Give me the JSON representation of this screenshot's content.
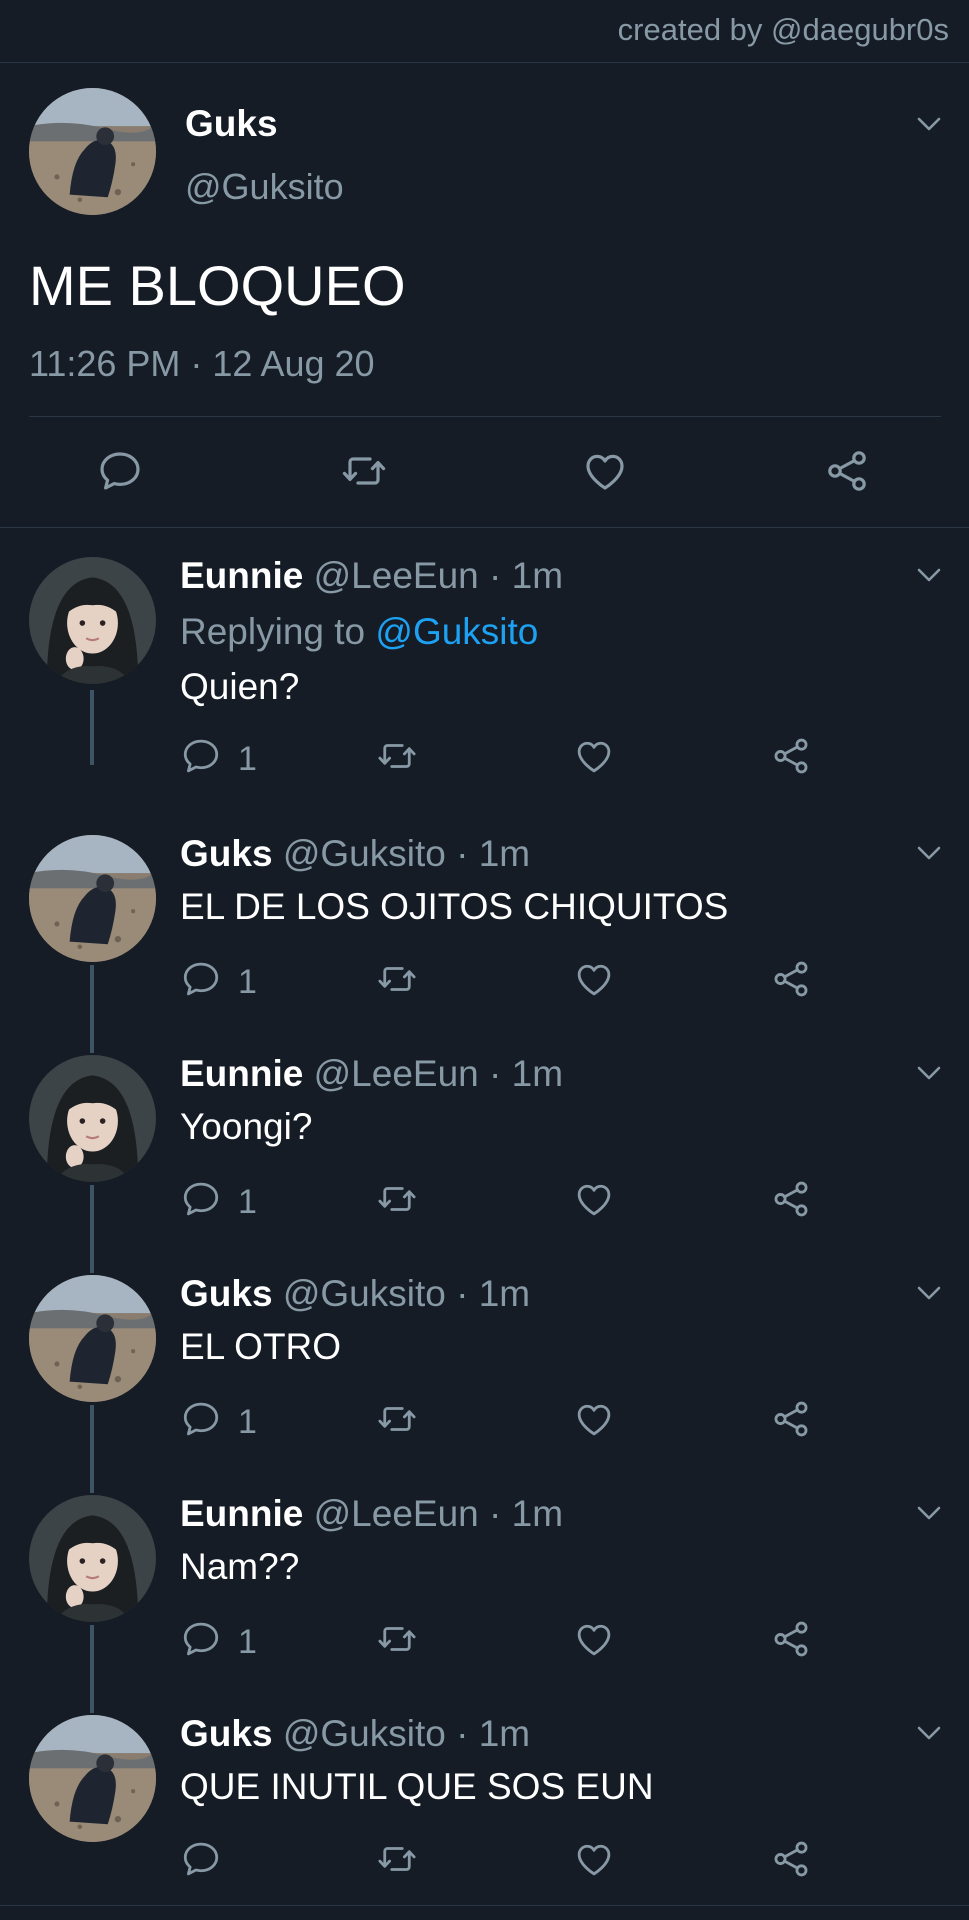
{
  "header": {
    "credit": "created by @daegubr0s"
  },
  "main_tweet": {
    "name": "Guks",
    "handle": "@Guksito",
    "text": "ME BLOQUEO",
    "timestamp": "11:26 PM · 12 Aug 20"
  },
  "replies": [
    {
      "name": "Eunnie",
      "meta": " @LeeEun · 1m",
      "replying_prefix": "Replying to ",
      "replying_to": "@Guksito",
      "text": "Quien?",
      "reply_count": "1"
    },
    {
      "name": "Guks",
      "meta": " @Guksito · 1m",
      "text": "EL DE LOS OJITOS CHIQUITOS",
      "reply_count": "1"
    },
    {
      "name": "Eunnie",
      "meta": " @LeeEun · 1m",
      "text": "Yoongi?",
      "reply_count": "1"
    },
    {
      "name": "Guks",
      "meta": " @Guksito · 1m",
      "text": "EL OTRO",
      "reply_count": "1"
    },
    {
      "name": "Eunnie",
      "meta": " @LeeEun · 1m",
      "text": "Nam??",
      "reply_count": "1"
    },
    {
      "name": "Guks",
      "meta": " @Guksito · 1m",
      "text": "QUE INUTIL QUE SOS EUN",
      "reply_count": ""
    }
  ],
  "colors": {
    "background": "#151c26",
    "secondary_text": "#8899a6",
    "link": "#1da1f2",
    "divider": "#2a3644",
    "thread_line": "#3d5466"
  },
  "icons": [
    "chevron-down-icon",
    "reply-icon",
    "retweet-icon",
    "like-icon",
    "share-icon"
  ]
}
